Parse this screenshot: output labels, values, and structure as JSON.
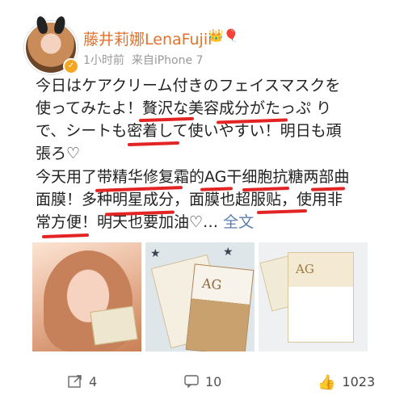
{
  "user": {
    "name": "藤井莉娜LenaFujii",
    "name_badges": "👑🎈",
    "time": "1小时前",
    "source": "来自iPhone 7"
  },
  "post": {
    "text_jp_line1": "今日はケアクリーム付きのフェイスマスクを",
    "text_jp_line2": "使ってみたよ！贅沢な美容成分がたっぷ り",
    "text_jp_line3": "で、シートも密着して使いやすい！明日も頑",
    "text_jp_line4": "張ろ♡",
    "text_cn_line1": "今天用了带精华修复霜的AG干细胞抗糖两部曲",
    "text_cn_line2": "面膜！多种明星成分，面膜也超服贴，使用非",
    "text_cn_line3": "常方便！明天也要加油♡…",
    "full_text_link": "全文"
  },
  "actions": {
    "forward_count": "4",
    "comment_count": "10",
    "like_count": "1023"
  },
  "colors": {
    "name": "#e5722b",
    "underline": "#e32424",
    "link": "#5b7fb0",
    "like": "#f07a2d"
  }
}
